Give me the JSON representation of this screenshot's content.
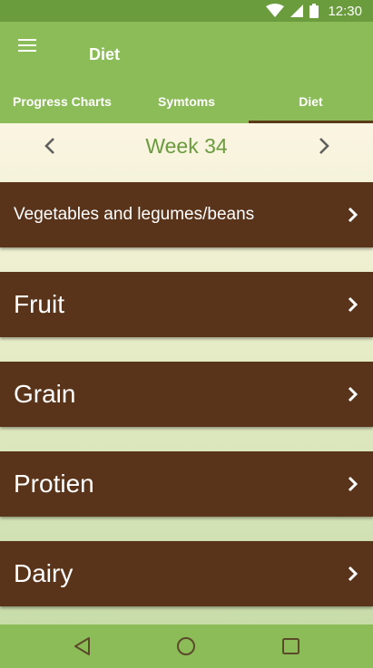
{
  "status_bar": {
    "time": "12:30",
    "icons": [
      "wifi-icon",
      "signal-icon",
      "battery-icon"
    ]
  },
  "app_bar": {
    "title": "Diet",
    "menu_icon": "hamburger-menu-icon"
  },
  "tabs": [
    {
      "label": "Progress Charts",
      "active": false
    },
    {
      "label": "Symtoms",
      "active": false
    },
    {
      "label": "Diet",
      "active": true
    }
  ],
  "week_nav": {
    "label": "Week 34",
    "prev_icon": "chevron-left-icon",
    "next_icon": "chevron-right-icon"
  },
  "categories": [
    {
      "label": "Vegetables and legumes/beans"
    },
    {
      "label": "Fruit"
    },
    {
      "label": "Grain"
    },
    {
      "label": "Protien"
    },
    {
      "label": "Dairy"
    }
  ],
  "system_nav": [
    "back-icon",
    "home-icon",
    "recents-icon"
  ],
  "colors": {
    "primary": "#8cbc58",
    "primary_dark": "#6a9b3d",
    "card": "#5a341a",
    "accent_text": "#6a9b3d"
  }
}
